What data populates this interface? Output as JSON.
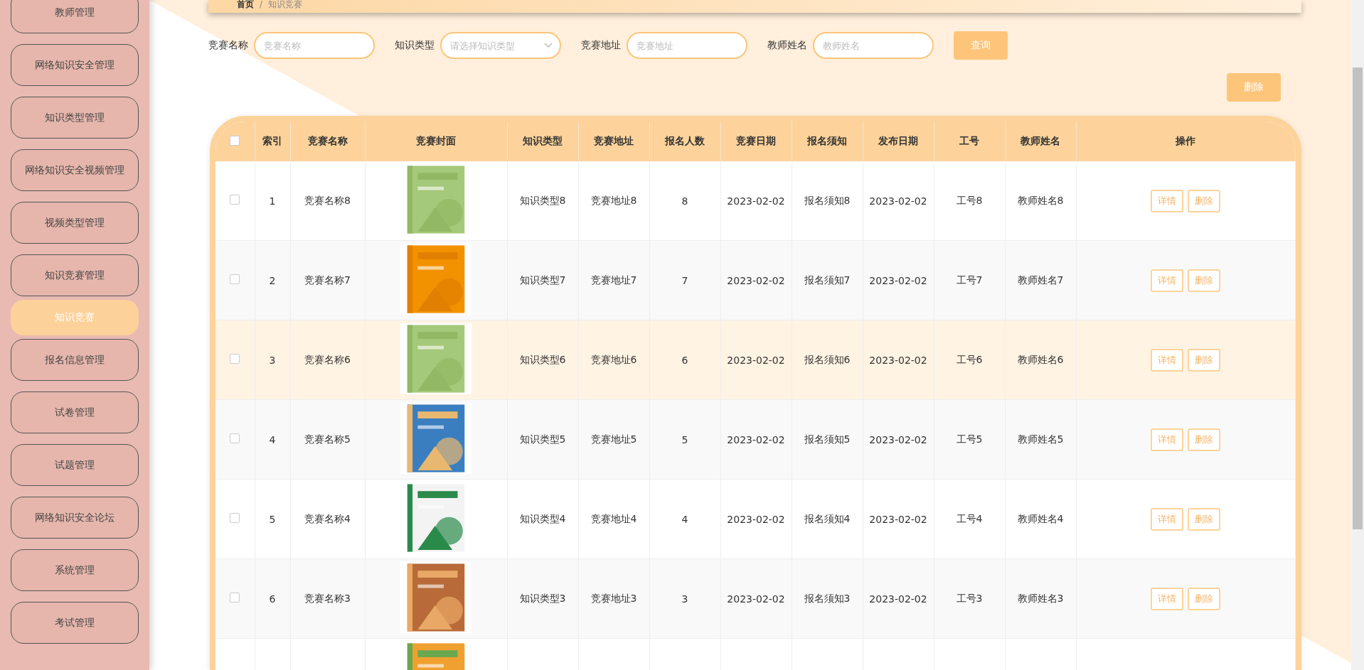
{
  "sidebar": {
    "items": [
      {
        "label": "教师管理",
        "selected": false
      },
      {
        "label": "网络知识安全管理",
        "selected": false
      },
      {
        "label": "知识类型管理",
        "selected": false
      },
      {
        "label": "网络知识安全视频管理",
        "selected": false
      },
      {
        "label": "视频类型管理",
        "selected": false
      },
      {
        "label": "知识竞赛管理",
        "selected": false
      },
      {
        "label": "知识竞赛",
        "selected": true
      },
      {
        "label": "报名信息管理",
        "selected": false
      },
      {
        "label": "试卷管理",
        "selected": false
      },
      {
        "label": "试题管理",
        "selected": false
      },
      {
        "label": "网络知识安全论坛",
        "selected": false
      },
      {
        "label": "系统管理",
        "selected": false
      },
      {
        "label": "考试管理",
        "selected": false
      }
    ]
  },
  "breadcrumb": [
    "首页",
    "/",
    "知识竞赛"
  ],
  "search": {
    "fields": [
      {
        "kind": "text",
        "label": "竞赛名称",
        "placeholder": "竞赛名称"
      },
      {
        "kind": "select",
        "label": "知识类型",
        "placeholder": "请选择知识类型"
      },
      {
        "kind": "text",
        "label": "竞赛地址",
        "placeholder": "竞赛地址"
      },
      {
        "kind": "text",
        "label": "教师姓名",
        "placeholder": "教师姓名"
      }
    ],
    "button": "查询"
  },
  "delete_button": "删除",
  "table": {
    "select_all": {
      "checked": false
    },
    "columns": [
      "索引",
      "竞赛名称",
      "竞赛封面",
      "知识类型",
      "竞赛地址",
      "报名人数",
      "竞赛日期",
      "报名须知",
      "发布日期",
      "工号",
      "教师姓名",
      "操作"
    ],
    "rows": [
      {
        "checked": false,
        "highlighted": false,
        "cells": [
          "1",
          "竞赛名称8",
          null,
          "知识类型8",
          "竞赛地址8",
          "8",
          "2023-02-02",
          "报名须知8",
          "2023-02-02",
          "工号8",
          "教师姓名8"
        ],
        "actions": [
          "详情",
          "删除"
        ]
      },
      {
        "checked": false,
        "highlighted": false,
        "cells": [
          "2",
          "竞赛名称7",
          null,
          "知识类型7",
          "竞赛地址7",
          "7",
          "2023-02-02",
          "报名须知7",
          "2023-02-02",
          "工号7",
          "教师姓名7"
        ],
        "actions": [
          "详情",
          "删除"
        ]
      },
      {
        "checked": false,
        "highlighted": true,
        "cells": [
          "3",
          "竞赛名称6",
          null,
          "知识类型6",
          "竞赛地址6",
          "6",
          "2023-02-02",
          "报名须知6",
          "2023-02-02",
          "工号6",
          "教师姓名6"
        ],
        "actions": [
          "详情",
          "删除"
        ]
      },
      {
        "checked": false,
        "highlighted": false,
        "cells": [
          "4",
          "竞赛名称5",
          null,
          "知识类型5",
          "竞赛地址5",
          "5",
          "2023-02-02",
          "报名须知5",
          "2023-02-02",
          "工号5",
          "教师姓名5"
        ],
        "actions": [
          "详情",
          "删除"
        ]
      },
      {
        "checked": false,
        "highlighted": false,
        "cells": [
          "5",
          "竞赛名称4",
          null,
          "知识类型4",
          "竞赛地址4",
          "4",
          "2023-02-02",
          "报名须知4",
          "2023-02-02",
          "工号4",
          "教师姓名4"
        ],
        "actions": [
          "详情",
          "删除"
        ]
      },
      {
        "checked": false,
        "highlighted": false,
        "cells": [
          "6",
          "竞赛名称3",
          null,
          "知识类型3",
          "竞赛地址3",
          "3",
          "2023-02-02",
          "报名须知3",
          "2023-02-02",
          "工号3",
          "教师姓名3"
        ],
        "actions": [
          "详情",
          "删除"
        ]
      },
      {
        "highlighted": false,
        "cells": [
          null,
          null,
          null,
          null,
          null,
          null,
          null,
          null,
          null,
          null,
          null
        ],
        "actions": []
      }
    ]
  }
}
